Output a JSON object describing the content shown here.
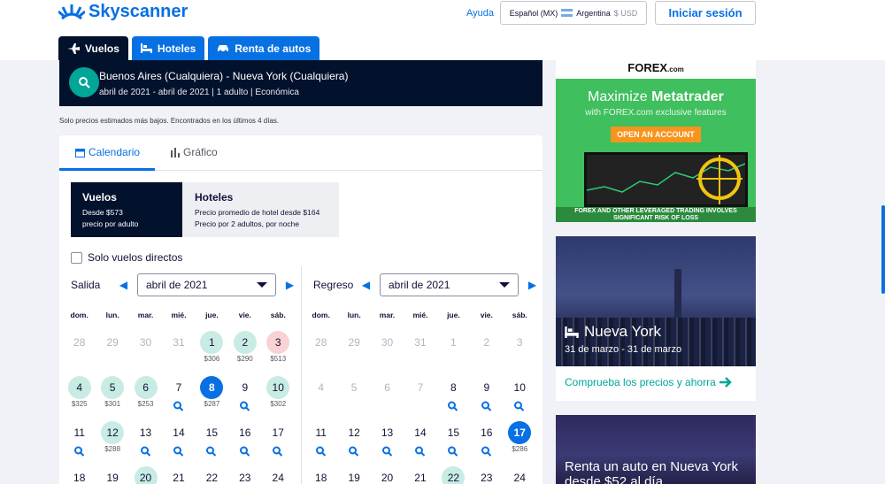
{
  "header": {
    "brand": "Skyscanner",
    "help": "Ayuda",
    "locale": {
      "language": "Español (MX)",
      "country": "Argentina",
      "currency": "$ USD"
    },
    "login": "Iniciar sesión"
  },
  "tabs": [
    {
      "label": "Vuelos",
      "icon": "plane-icon",
      "active": true
    },
    {
      "label": "Hoteles",
      "icon": "bed-icon",
      "active": false
    },
    {
      "label": "Renta de autos",
      "icon": "car-icon",
      "active": false
    }
  ],
  "search_summary": {
    "route": "Buenos Aires (Cualquiera) - Nueva York (Cualquiera)",
    "details": "abril de 2021 - abril de 2021 | 1 adulto | Económica"
  },
  "note": "Solo precios estimados más bajos. Encontrados en los últimos 4 días.",
  "view_tabs": {
    "calendar": "Calendario",
    "graph": "Gráfico"
  },
  "price_toggle": {
    "flights": {
      "title": "Vuelos",
      "line1": "Desde $573",
      "line2": "precio por adulto"
    },
    "hotels": {
      "title": "Hoteles",
      "line1": "Precio promedio de hotel desde $164",
      "line2": "Precio por 2 adultos, por noche"
    }
  },
  "direct_only": "Solo vuelos directos",
  "calendar": {
    "weekdays": [
      "dom.",
      "lun.",
      "mar.",
      "mié.",
      "jue.",
      "vie.",
      "sáb."
    ],
    "outbound": {
      "label": "Salida",
      "month": "abril de 2021",
      "weeks": [
        [
          {
            "d": "28",
            "s": "off"
          },
          {
            "d": "29",
            "s": "off"
          },
          {
            "d": "30",
            "s": "off"
          },
          {
            "d": "31",
            "s": "off"
          },
          {
            "d": "1",
            "s": "cheap",
            "p": "$306"
          },
          {
            "d": "2",
            "s": "cheap",
            "p": "$290"
          },
          {
            "d": "3",
            "s": "hi",
            "p": "$513"
          }
        ],
        [
          {
            "d": "4",
            "s": "cheap",
            "p": "$325"
          },
          {
            "d": "5",
            "s": "cheap",
            "p": "$301"
          },
          {
            "d": "6",
            "s": "cheap",
            "p": "$253"
          },
          {
            "d": "7",
            "s": "search"
          },
          {
            "d": "8",
            "s": "sel",
            "p": "$287"
          },
          {
            "d": "9",
            "s": "search"
          },
          {
            "d": "10",
            "s": "cheap",
            "p": "$302"
          }
        ],
        [
          {
            "d": "11",
            "s": "search"
          },
          {
            "d": "12",
            "s": "cheap",
            "p": "$288"
          },
          {
            "d": "13",
            "s": "search"
          },
          {
            "d": "14",
            "s": "search"
          },
          {
            "d": "15",
            "s": "search"
          },
          {
            "d": "16",
            "s": "search"
          },
          {
            "d": "17",
            "s": "search"
          }
        ],
        [
          {
            "d": "18",
            "s": "plain"
          },
          {
            "d": "19",
            "s": "plain"
          },
          {
            "d": "20",
            "s": "cheap"
          },
          {
            "d": "21",
            "s": "plain"
          },
          {
            "d": "22",
            "s": "plain"
          },
          {
            "d": "23",
            "s": "plain"
          },
          {
            "d": "24",
            "s": "plain"
          }
        ]
      ]
    },
    "return": {
      "label": "Regreso",
      "month": "abril de 2021",
      "weeks": [
        [
          {
            "d": "28",
            "s": "off"
          },
          {
            "d": "29",
            "s": "off"
          },
          {
            "d": "30",
            "s": "off"
          },
          {
            "d": "31",
            "s": "off"
          },
          {
            "d": "1",
            "s": "off"
          },
          {
            "d": "2",
            "s": "off"
          },
          {
            "d": "3",
            "s": "off"
          }
        ],
        [
          {
            "d": "4",
            "s": "off"
          },
          {
            "d": "5",
            "s": "off"
          },
          {
            "d": "6",
            "s": "off"
          },
          {
            "d": "7",
            "s": "off"
          },
          {
            "d": "8",
            "s": "search"
          },
          {
            "d": "9",
            "s": "search"
          },
          {
            "d": "10",
            "s": "search"
          }
        ],
        [
          {
            "d": "11",
            "s": "search"
          },
          {
            "d": "12",
            "s": "search"
          },
          {
            "d": "13",
            "s": "search"
          },
          {
            "d": "14",
            "s": "search"
          },
          {
            "d": "15",
            "s": "search"
          },
          {
            "d": "16",
            "s": "search"
          },
          {
            "d": "17",
            "s": "sel",
            "p": "$286"
          }
        ],
        [
          {
            "d": "18",
            "s": "plain"
          },
          {
            "d": "19",
            "s": "plain"
          },
          {
            "d": "20",
            "s": "plain"
          },
          {
            "d": "21",
            "s": "plain"
          },
          {
            "d": "22",
            "s": "cheap"
          },
          {
            "d": "23",
            "s": "plain"
          },
          {
            "d": "24",
            "s": "plain"
          }
        ]
      ]
    }
  },
  "ad": {
    "brand": "FOREX",
    "brand_suffix": ".com",
    "headline_pre": "Maximize ",
    "headline_bold": "Metatrader",
    "sub": "with FOREX.com exclusive features",
    "cta": "OPEN AN ACCOUNT",
    "footer_line1": "FOREX AND OTHER LEVERAGED TRADING INVOLVES",
    "footer_line2": "SIGNIFICANT RISK OF LOSS"
  },
  "promos": {
    "ny": {
      "title": "Nueva York",
      "dates": "31 de marzo - 31 de marzo",
      "link": "Comprueba los precios y ahorra"
    },
    "car": {
      "title": "Renta un auto en Nueva York desde $52 al día"
    }
  },
  "colors": {
    "brand": "#0770e3",
    "navy": "#02122c",
    "teal": "#00a698",
    "cheap": "#c8ebe3",
    "expensive": "#f9d2d4"
  }
}
